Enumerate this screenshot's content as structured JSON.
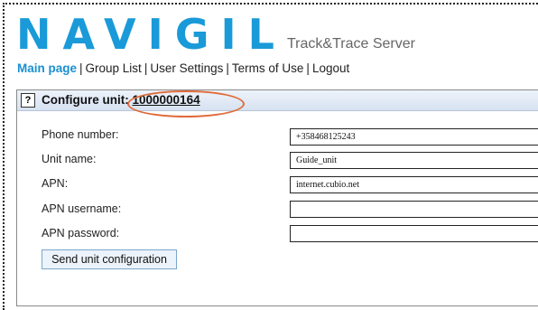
{
  "header": {
    "logo": "NAVIGIL",
    "subtitle": "Track&Trace Server"
  },
  "nav": {
    "items": [
      "Main page",
      "Group List",
      "User Settings",
      "Terms of Use",
      "Logout"
    ],
    "separator": "|",
    "active": "Main page"
  },
  "panel": {
    "help_label": "?",
    "title_prefix": "Configure unit:",
    "unit_id": "1000000164",
    "fields": [
      {
        "label": "Phone number:",
        "value": "+358468125243"
      },
      {
        "label": "Unit name:",
        "value": "Guide_unit"
      },
      {
        "label": "APN:",
        "value": "internet.cubio.net"
      },
      {
        "label": "APN username:",
        "value": ""
      },
      {
        "label": "APN password:",
        "value": ""
      }
    ],
    "submit_label": "Send unit configuration"
  },
  "colors": {
    "brand": "#1a9ad8",
    "highlight_ellipse": "#e06b3a"
  }
}
